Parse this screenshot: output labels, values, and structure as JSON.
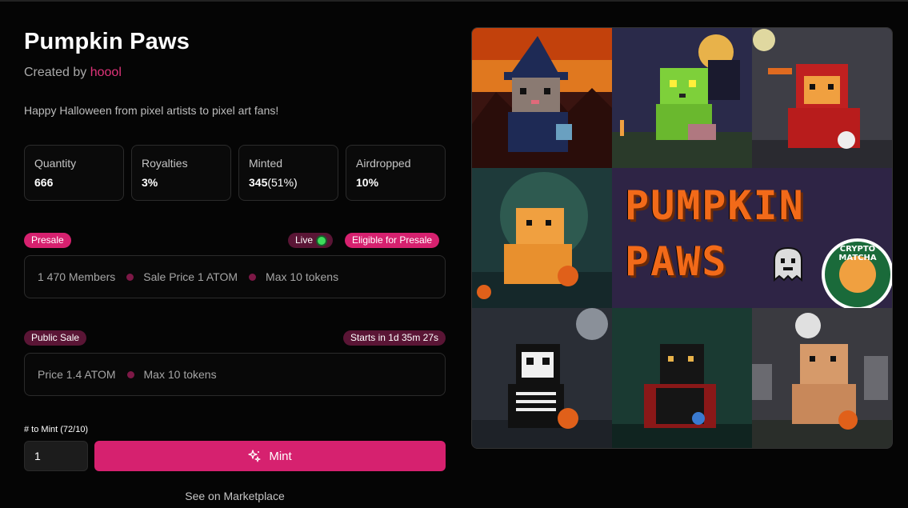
{
  "collection": {
    "title": "Pumpkin Paws",
    "created_by_label": "Created by",
    "creator": "hoool",
    "description": "Happy Halloween from pixel artists to pixel art fans!"
  },
  "stats": [
    {
      "label": "Quantity",
      "value": "666",
      "sub": ""
    },
    {
      "label": "Royalties",
      "value": "3%",
      "sub": ""
    },
    {
      "label": "Minted",
      "value": "345",
      "sub": "(51%)"
    },
    {
      "label": "Airdropped",
      "value": "10%",
      "sub": ""
    }
  ],
  "presale": {
    "tag": "Presale",
    "live_label": "Live",
    "eligible_label": "Eligible for Presale",
    "members": "1 470 Members",
    "price": "Sale Price 1 ATOM",
    "max": "Max 10 tokens"
  },
  "public_sale": {
    "tag": "Public Sale",
    "starts_label": "Starts in 1d 35m 27s",
    "price": "Price 1.4 ATOM",
    "max": "Max 10 tokens"
  },
  "mint": {
    "label": "# to Mint (72/10)",
    "quantity_value": "1",
    "button_label": "Mint",
    "button_icon": "sparkle-icon",
    "marketplace_link": "See on Marketplace"
  },
  "artwork": {
    "logo_line1": "PUMPKIN",
    "logo_line2": "PAWS",
    "badge_text": "CRYPTO MATCHA"
  },
  "colors": {
    "accent": "#d6216f",
    "accent_dark": "#5a1535",
    "live": "#3ddc5b",
    "background": "#050505"
  }
}
